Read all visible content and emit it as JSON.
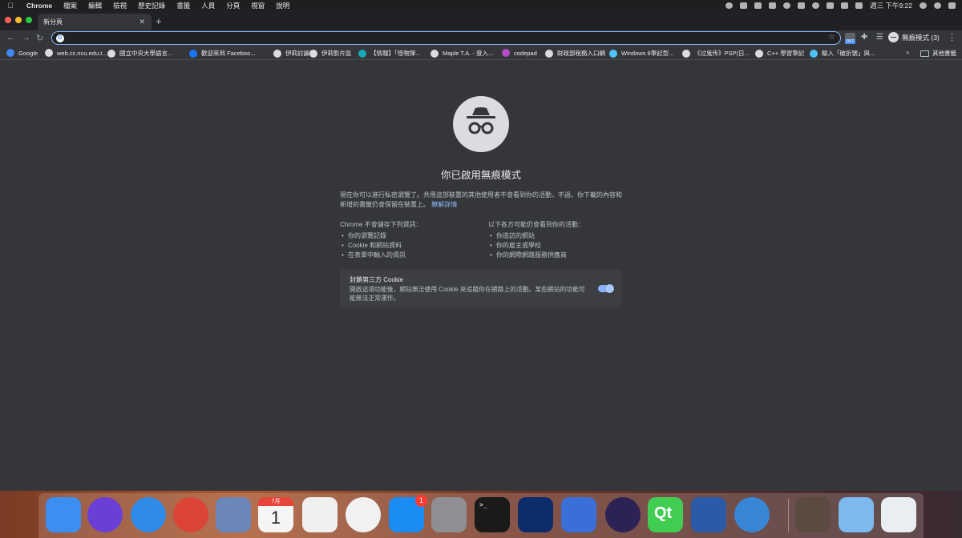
{
  "menubar": {
    "apple": "",
    "items": [
      "Chrome",
      "檔案",
      "編輯",
      "檢視",
      "歷史記錄",
      "書籤",
      "人員",
      "分頁",
      "視窗",
      "說明"
    ],
    "clock": "週三 下午9:22"
  },
  "tabs": [
    {
      "title": "新分頁"
    }
  ],
  "toolbar": {
    "address_value": "",
    "ext_badge": "OFF",
    "profile_label": "無痕模式 (3)"
  },
  "bookmarks": [
    {
      "label": "Google",
      "icon": "google-favicon",
      "color": "#4285f4"
    },
    {
      "label": "web.cc.ncu.edu.t...",
      "icon": "globe-icon",
      "color": "#dadce0"
    },
    {
      "label": "國立中央大學語言...",
      "icon": "globe-icon",
      "color": "#dadce0"
    },
    {
      "label": "歡迎來到 Faceboo...",
      "icon": "facebook-icon",
      "color": "#1877f2"
    },
    {
      "label": "伊莉討論區",
      "icon": "globe-icon",
      "color": "#dadce0"
    },
    {
      "label": "伊莉影片區",
      "icon": "globe-icon",
      "color": "#dadce0"
    },
    {
      "label": "【情報】「怪物彈...",
      "icon": "gamer-icon",
      "color": "#17a7b8"
    },
    {
      "label": "Maple T.A. - 登入...",
      "icon": "globe-icon",
      "color": "#dadce0"
    },
    {
      "label": "codepad",
      "icon": "codepad-icon",
      "color": "#b14cc4"
    },
    {
      "label": "財政部稅務入口網",
      "icon": "globe-icon",
      "color": "#dadce0"
    },
    {
      "label": "Windows 8筆記型...",
      "icon": "star-favicon",
      "color": "#4fc3f7"
    },
    {
      "label": "《过鬼传》PSP(日...",
      "icon": "globe-icon",
      "color": "#dadce0"
    },
    {
      "label": "C++ 學習筆記",
      "icon": "globe-icon",
      "color": "#dadce0"
    },
    {
      "label": "輸入「破折號」與...",
      "icon": "star-favicon",
      "color": "#4fc3f7"
    }
  ],
  "bookmarks_more": "»",
  "bookmarks_folder": "其他書籤",
  "incognito": {
    "title": "你已啟用無痕模式",
    "intro": "現在你可以進行私密瀏覽了。共用這部裝置的其他使用者不會看到你的活動，不過，你下載的內容和新增的書籤仍會保留在裝置上。",
    "learn_more": "瞭解詳情",
    "col1_title": "Chrome 不會儲存下列資訊：",
    "col1_items": [
      "你的瀏覽記錄",
      "Cookie 和網站資料",
      "在表單中輸入的資訊"
    ],
    "col2_title": "以下各方可能仍會看到你的活動：",
    "col2_items": [
      "你造訪的網站",
      "你的雇主或學校",
      "你的網際網路服務供應商"
    ],
    "cookie_title": "封鎖第三方 Cookie",
    "cookie_desc": "開啟這項功能後，網站無法使用 Cookie 來追蹤你在網路上的活動。某些網站的功能可能無法正常運作。",
    "cookie_toggle_on": true
  },
  "dock": {
    "badge_count": "1",
    "calendar_month": "7月",
    "calendar_day": "1",
    "terminal_prompt": ">_",
    "qt_label": "Qt",
    "apps": [
      {
        "name": "finder-icon",
        "color": "#3d8ef0"
      },
      {
        "name": "siri-icon",
        "color": "#6a3fd6"
      },
      {
        "name": "safari-icon",
        "color": "#2e8be8"
      },
      {
        "name": "chrome-icon",
        "color": "#db4437"
      },
      {
        "name": "preview-icon",
        "color": "#6b86b8"
      },
      {
        "name": "calendar-icon",
        "color": "#f5f5f5"
      },
      {
        "name": "photos-icon",
        "color": "#f0f0f0"
      },
      {
        "name": "itunes-icon",
        "color": "#f1f1f1"
      },
      {
        "name": "app-store-icon",
        "color": "#1b8cf3"
      },
      {
        "name": "system-preferences-icon",
        "color": "#8e8e93"
      },
      {
        "name": "terminal-icon",
        "color": "#1a1a1a"
      },
      {
        "name": "dropbox-icon",
        "color": "#0d2c6b"
      },
      {
        "name": "google-drive-icon",
        "color": "#3a6fd8"
      },
      {
        "name": "eclipse-icon",
        "color": "#2c2255"
      },
      {
        "name": "qt-creator-icon",
        "color": "#41cd52"
      },
      {
        "name": "virtualbox-icon",
        "color": "#2a5aa8"
      },
      {
        "name": "quicktime-icon",
        "color": "#3a86d6"
      },
      {
        "name": "desktop-folder-icon",
        "color": "#5b4a3f"
      },
      {
        "name": "documents-folder-icon",
        "color": "#7cb9ee"
      },
      {
        "name": "trash-icon",
        "color": "#e9eef3"
      }
    ]
  }
}
